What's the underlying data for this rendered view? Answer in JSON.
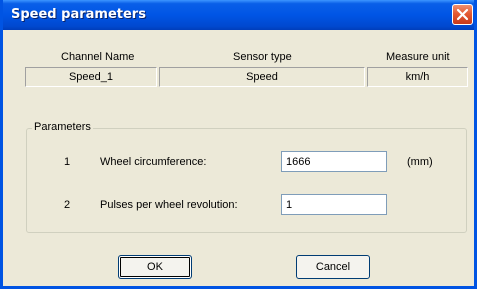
{
  "window": {
    "title": "Speed parameters"
  },
  "channel_table": {
    "headers": [
      "Channel Name",
      "Sensor type",
      "Measure unit"
    ],
    "row": [
      "Speed_1",
      "Speed",
      "km/h"
    ]
  },
  "parameters": {
    "group_label": "Parameters",
    "rows": [
      {
        "num": "1",
        "label": "Wheel circumference:",
        "value": "1666",
        "unit": "(mm)"
      },
      {
        "num": "2",
        "label": "Pulses per wheel revolution:",
        "value": "1",
        "unit": ""
      }
    ]
  },
  "buttons": {
    "ok": "OK",
    "cancel": "Cancel"
  },
  "icons": {
    "close": "close-icon"
  },
  "colors": {
    "titlebar": "#0055e5",
    "close": "#e45a33",
    "dialog_bg": "#ece9d8"
  }
}
